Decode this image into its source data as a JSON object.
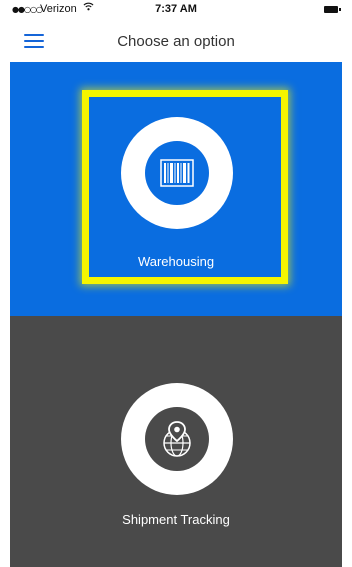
{
  "status_bar": {
    "signal": "●●○○○",
    "carrier": "Verizon",
    "wifi_icon": "wifi-icon",
    "time": "7:37 AM",
    "battery_icon": "battery-icon"
  },
  "nav": {
    "menu_icon": "hamburger-menu-icon",
    "title": "Choose an option"
  },
  "options": [
    {
      "label": "Warehousing",
      "icon": "barcode-icon",
      "background": "#0a6de0",
      "highlighted": true
    },
    {
      "label": "Shipment Tracking",
      "icon": "globe-location-pin-icon",
      "background": "#4a4a4a",
      "highlighted": false
    }
  ],
  "colors": {
    "accent": "#1565d8",
    "highlight": "#f5f500"
  }
}
